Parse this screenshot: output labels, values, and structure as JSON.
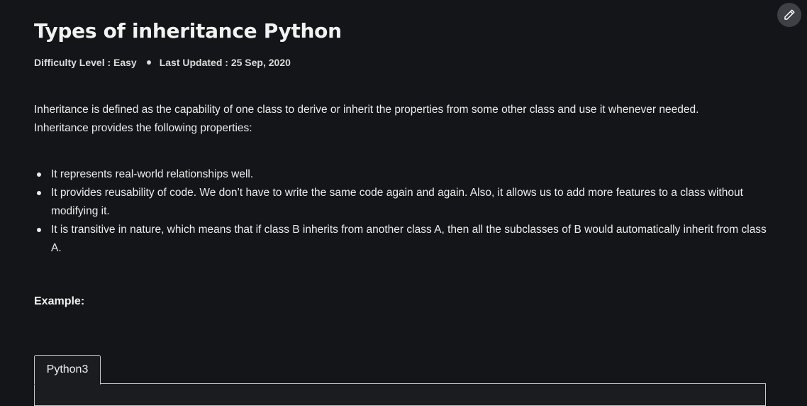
{
  "article": {
    "title": "Types of inheritance Python",
    "meta": {
      "difficulty": "Difficulty Level : Easy",
      "last_updated": "Last Updated : 25 Sep, 2020"
    },
    "intro": "Inheritance is defined as the capability of one class to derive or inherit the properties from some other class and use it whenever needed. Inheritance provides the following properties:",
    "bullets": [
      "It represents real-world relationships well.",
      "It provides reusability of code. We don’t have to write the same code again and again. Also, it allows us to add more features to a class without modifying it.",
      "It is transitive in nature, which means that if class B inherits from another class A, then all the subclasses of B would automatically inherit from class A."
    ],
    "example_label": "Example:",
    "code_tab": "Python3"
  },
  "icons": {
    "edit": "pencil-icon"
  }
}
